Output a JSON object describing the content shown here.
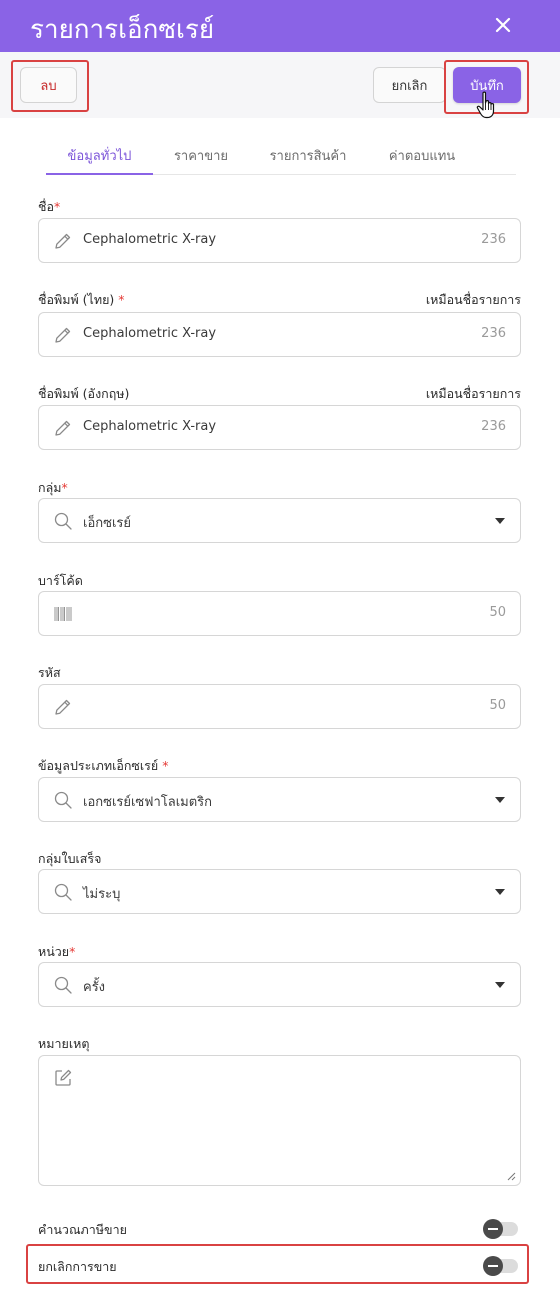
{
  "header": {
    "title": "รายการเอ็กซเรย์"
  },
  "toolbar": {
    "delete_label": "ลบ",
    "cancel_label": "ยกเลิก",
    "save_label": "บันทึก"
  },
  "tabs": [
    {
      "label": "ข้อมูลทั่วไป",
      "active": true
    },
    {
      "label": "ราคาขาย"
    },
    {
      "label": "รายการสินค้า"
    },
    {
      "label": "ค่าตอบแทน"
    }
  ],
  "form": {
    "name": {
      "label": "ชื่อ",
      "required": "*",
      "value": "Cephalometric X-ray",
      "count": "236"
    },
    "print_name_th": {
      "label": "ชื่อพิมพ์ (ไทย)",
      "required": "*",
      "right_label": "เหมือนชื่อรายการ",
      "value": "Cephalometric X-ray",
      "count": "236"
    },
    "print_name_en": {
      "label": "ชื่อพิมพ์ (อังกฤษ)",
      "right_label": "เหมือนชื่อรายการ",
      "value": "Cephalometric X-ray",
      "count": "236"
    },
    "group": {
      "label": "กลุ่ม",
      "required": "*",
      "value": "เอ็กซเรย์"
    },
    "barcode": {
      "label": "บาร์โค้ด",
      "value": "",
      "count": "50"
    },
    "code": {
      "label": "รหัส",
      "value": "",
      "count": "50"
    },
    "xray_type": {
      "label": "ข้อมูลประเภทเอ็กซเรย์",
      "required": "*",
      "value": "เอกซเรย์เซฟาโลเมตริก"
    },
    "receipt_group": {
      "label": "กลุ่มใบเสร็จ",
      "value": "ไม่ระบุ"
    },
    "unit": {
      "label": "หน่วย",
      "required": "*",
      "value": "ครั้ง"
    },
    "note": {
      "label": "หมายเหตุ",
      "value": ""
    },
    "calc_tax": {
      "label": "คำนวณภาษีขาย",
      "on": false
    },
    "cancel_sale": {
      "label": "ยกเลิกการขาย",
      "on": false
    }
  },
  "colors": {
    "accent": "#8a63e6",
    "danger": "#d94242"
  }
}
